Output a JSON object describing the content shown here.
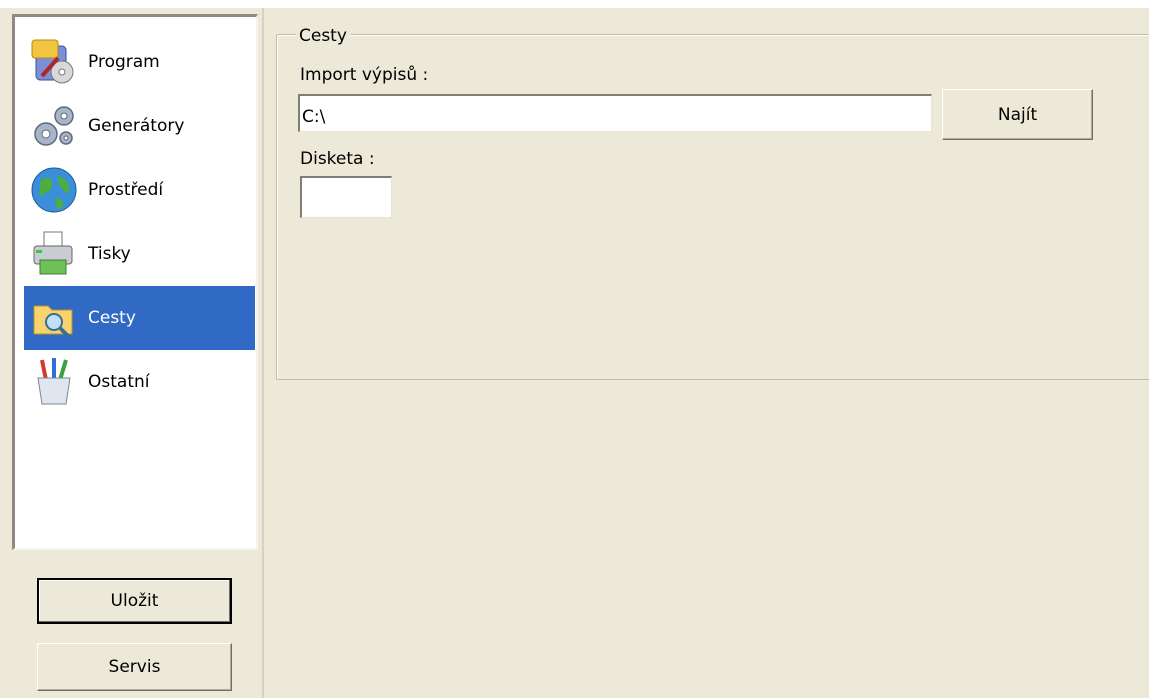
{
  "sidebar": {
    "items": [
      {
        "label": "Program",
        "icon": "program-icon",
        "selected": false
      },
      {
        "label": "Generátory",
        "icon": "gears-icon",
        "selected": false
      },
      {
        "label": "Prostředí",
        "icon": "globe-icon",
        "selected": false
      },
      {
        "label": "Tisky",
        "icon": "printer-icon",
        "selected": false
      },
      {
        "label": "Cesty",
        "icon": "folder-search-icon",
        "selected": true
      },
      {
        "label": "Ostatní",
        "icon": "pencil-cup-icon",
        "selected": false
      }
    ],
    "selected_color": "#316ac5"
  },
  "buttons": {
    "save_label": "Uložit",
    "service_label": "Servis"
  },
  "panel": {
    "group_title": "Cesty",
    "import_label": "Import výpisů :",
    "import_value": "C:\\",
    "find_label": "Najít",
    "disk_label": "Disketa :",
    "disk_value": ""
  }
}
